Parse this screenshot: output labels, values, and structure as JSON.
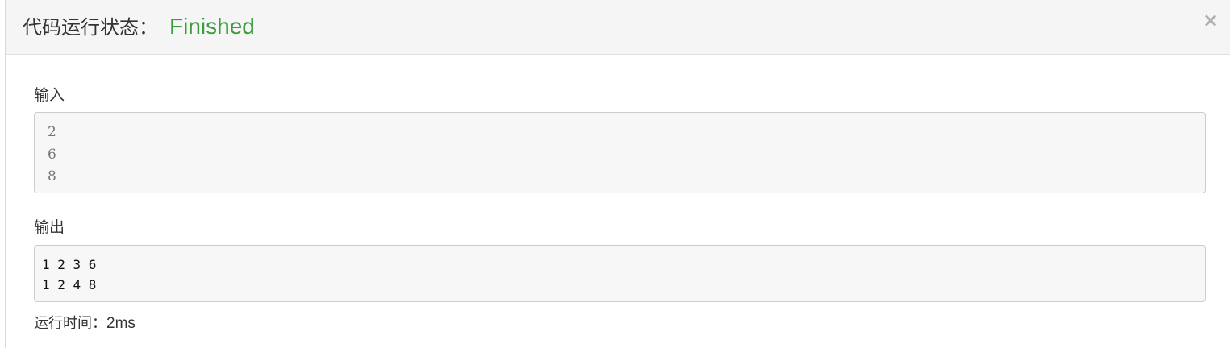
{
  "header": {
    "title_label": "代码运行状态：",
    "status": "Finished",
    "close_symbol": "×"
  },
  "colors": {
    "status_finished": "#3c9d3c",
    "header_bg": "#f5f5f5",
    "box_bg": "#f7f7f7"
  },
  "input_section": {
    "label": "输入",
    "lines": [
      "2",
      "6",
      "8"
    ]
  },
  "output_section": {
    "label": "输出",
    "lines": [
      "1 2 3 6",
      "1 2 4 8"
    ]
  },
  "footer": {
    "runtime_label": "运行时间：",
    "runtime_value": "2ms"
  },
  "icons": {
    "close": "close-icon"
  }
}
